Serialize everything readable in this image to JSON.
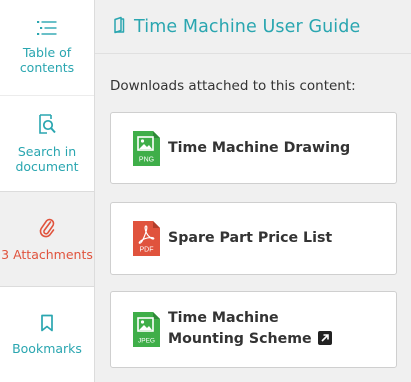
{
  "sidebar": {
    "items": [
      {
        "label_line1": "Table of",
        "label_line2": "contents",
        "icon": "list-icon"
      },
      {
        "label_line1": "Search in",
        "label_line2": "document",
        "icon": "search-document-icon"
      },
      {
        "label": "3 Attachments",
        "icon": "paperclip-icon",
        "active": true
      },
      {
        "label": "Bookmarks",
        "icon": "bookmark-icon"
      }
    ]
  },
  "header": {
    "title": "Time Machine User Guide",
    "icon": "book-icon"
  },
  "main": {
    "intro": "Downloads attached to this content:",
    "attachments": [
      {
        "name": "Time Machine Drawing",
        "type": "PNG",
        "icon": "image-file-icon",
        "color": "#3fae49"
      },
      {
        "name": "Spare Part Price List",
        "type": "PDF",
        "icon": "pdf-file-icon",
        "color": "#e0533d"
      },
      {
        "name_line1": "Time Machine",
        "name_line2": "Mounting Scheme",
        "type": "JPEG",
        "icon": "image-file-icon",
        "color": "#3fae49",
        "external": true,
        "external_icon": "external-link-icon"
      }
    ]
  },
  "colors": {
    "accent": "#2aa6b0",
    "active": "#e0533d",
    "image_file": "#3fae49",
    "pdf_file": "#e0533d"
  }
}
